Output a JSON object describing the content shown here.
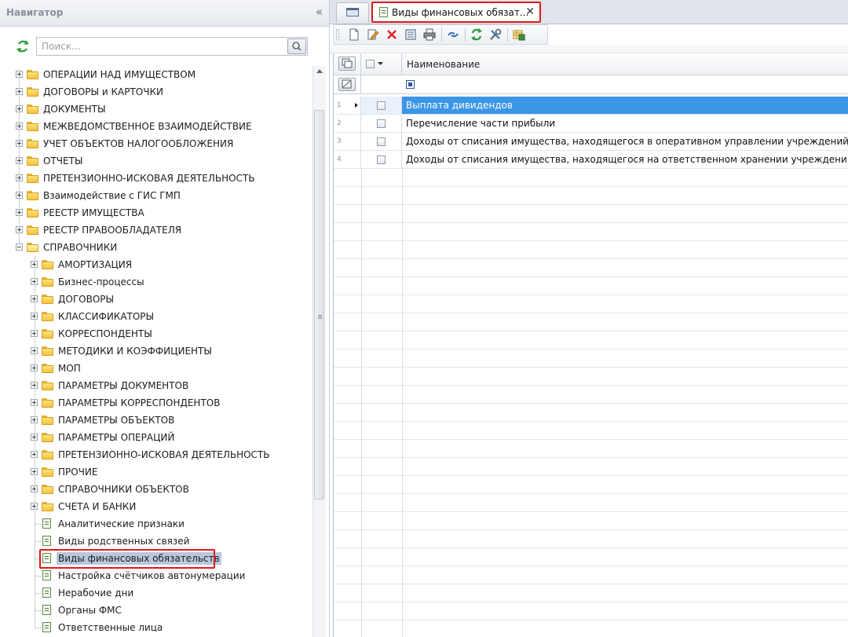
{
  "navigator": {
    "title": "Навигатор",
    "search_placeholder": "Поиск...",
    "tree": [
      {
        "label": "ОПЕРАЦИИ НАД ИМУЩЕСТВОМ"
      },
      {
        "label": "ДОГОВОРЫ и КАРТОЧКИ"
      },
      {
        "label": "ДОКУМЕНТЫ"
      },
      {
        "label": "МЕЖВЕДОМСТВЕННОЕ ВЗАИМОДЕЙСТВИЕ"
      },
      {
        "label": "УЧЕТ ОБЪЕКТОВ НАЛОГООБЛОЖЕНИЯ"
      },
      {
        "label": "ОТЧЕТЫ"
      },
      {
        "label": "ПРЕТЕНЗИОННО-ИСКОВАЯ ДЕЯТЕЛЬНОСТЬ"
      },
      {
        "label": "Взаимодействие с ГИС ГМП"
      },
      {
        "label": "РЕЕСТР ИМУЩЕСТВА"
      },
      {
        "label": "РЕЕСТР ПРАВООБЛАДАТЕЛЯ"
      },
      {
        "label": "СПРАВОЧНИКИ"
      }
    ],
    "children": [
      {
        "label": "АМОРТИЗАЦИЯ"
      },
      {
        "label": "Бизнес-процессы"
      },
      {
        "label": "ДОГОВОРЫ"
      },
      {
        "label": "КЛАССИФИКАТОРЫ"
      },
      {
        "label": "КОРРЕСПОНДЕНТЫ"
      },
      {
        "label": "МЕТОДИКИ И КОЭФФИЦИЕНТЫ"
      },
      {
        "label": "МОП"
      },
      {
        "label": "ПАРАМЕТРЫ ДОКУМЕНТОВ"
      },
      {
        "label": "ПАРАМЕТРЫ КОРРЕСПОНДЕНТОВ"
      },
      {
        "label": "ПАРАМЕТРЫ ОБЪЕКТОВ"
      },
      {
        "label": "ПАРАМЕТРЫ ОПЕРАЦИЙ"
      },
      {
        "label": "ПРЕТЕНЗИОННО-ИСКОВАЯ ДЕЯТЕЛЬНОСТЬ"
      },
      {
        "label": "ПРОЧИЕ"
      },
      {
        "label": "СПРАВОЧНИКИ ОБЪЕКТОВ"
      },
      {
        "label": "СЧЕТА И БАНКИ"
      }
    ],
    "leaves": [
      {
        "label": "Аналитические признаки"
      },
      {
        "label": "Виды родственных связей"
      },
      {
        "label": "Виды финансовых обязательств"
      },
      {
        "label": "Настройка счётчиков автонумерации"
      },
      {
        "label": "Нерабочие дни"
      },
      {
        "label": "Органы ФМС"
      },
      {
        "label": "Ответственные лица"
      }
    ]
  },
  "tabs": {
    "active_title": "Виды финансовых обязат...",
    "close_glyph": "✕"
  },
  "grid": {
    "column_name": "Наименование",
    "rows": [
      {
        "num": "1",
        "name": "Выплата дивидендов"
      },
      {
        "num": "2",
        "name": "Перечисление части прибыли"
      },
      {
        "num": "3",
        "name": "Доходы от списания имущества, находящегося в оперативном управлении учреждений"
      },
      {
        "num": "4",
        "name": "Доходы от списания имущества, находящегося на ответственном хранении учреждения"
      }
    ]
  },
  "colors": {
    "selection": "#3c96e6",
    "highlight_box": "#e0191b"
  }
}
